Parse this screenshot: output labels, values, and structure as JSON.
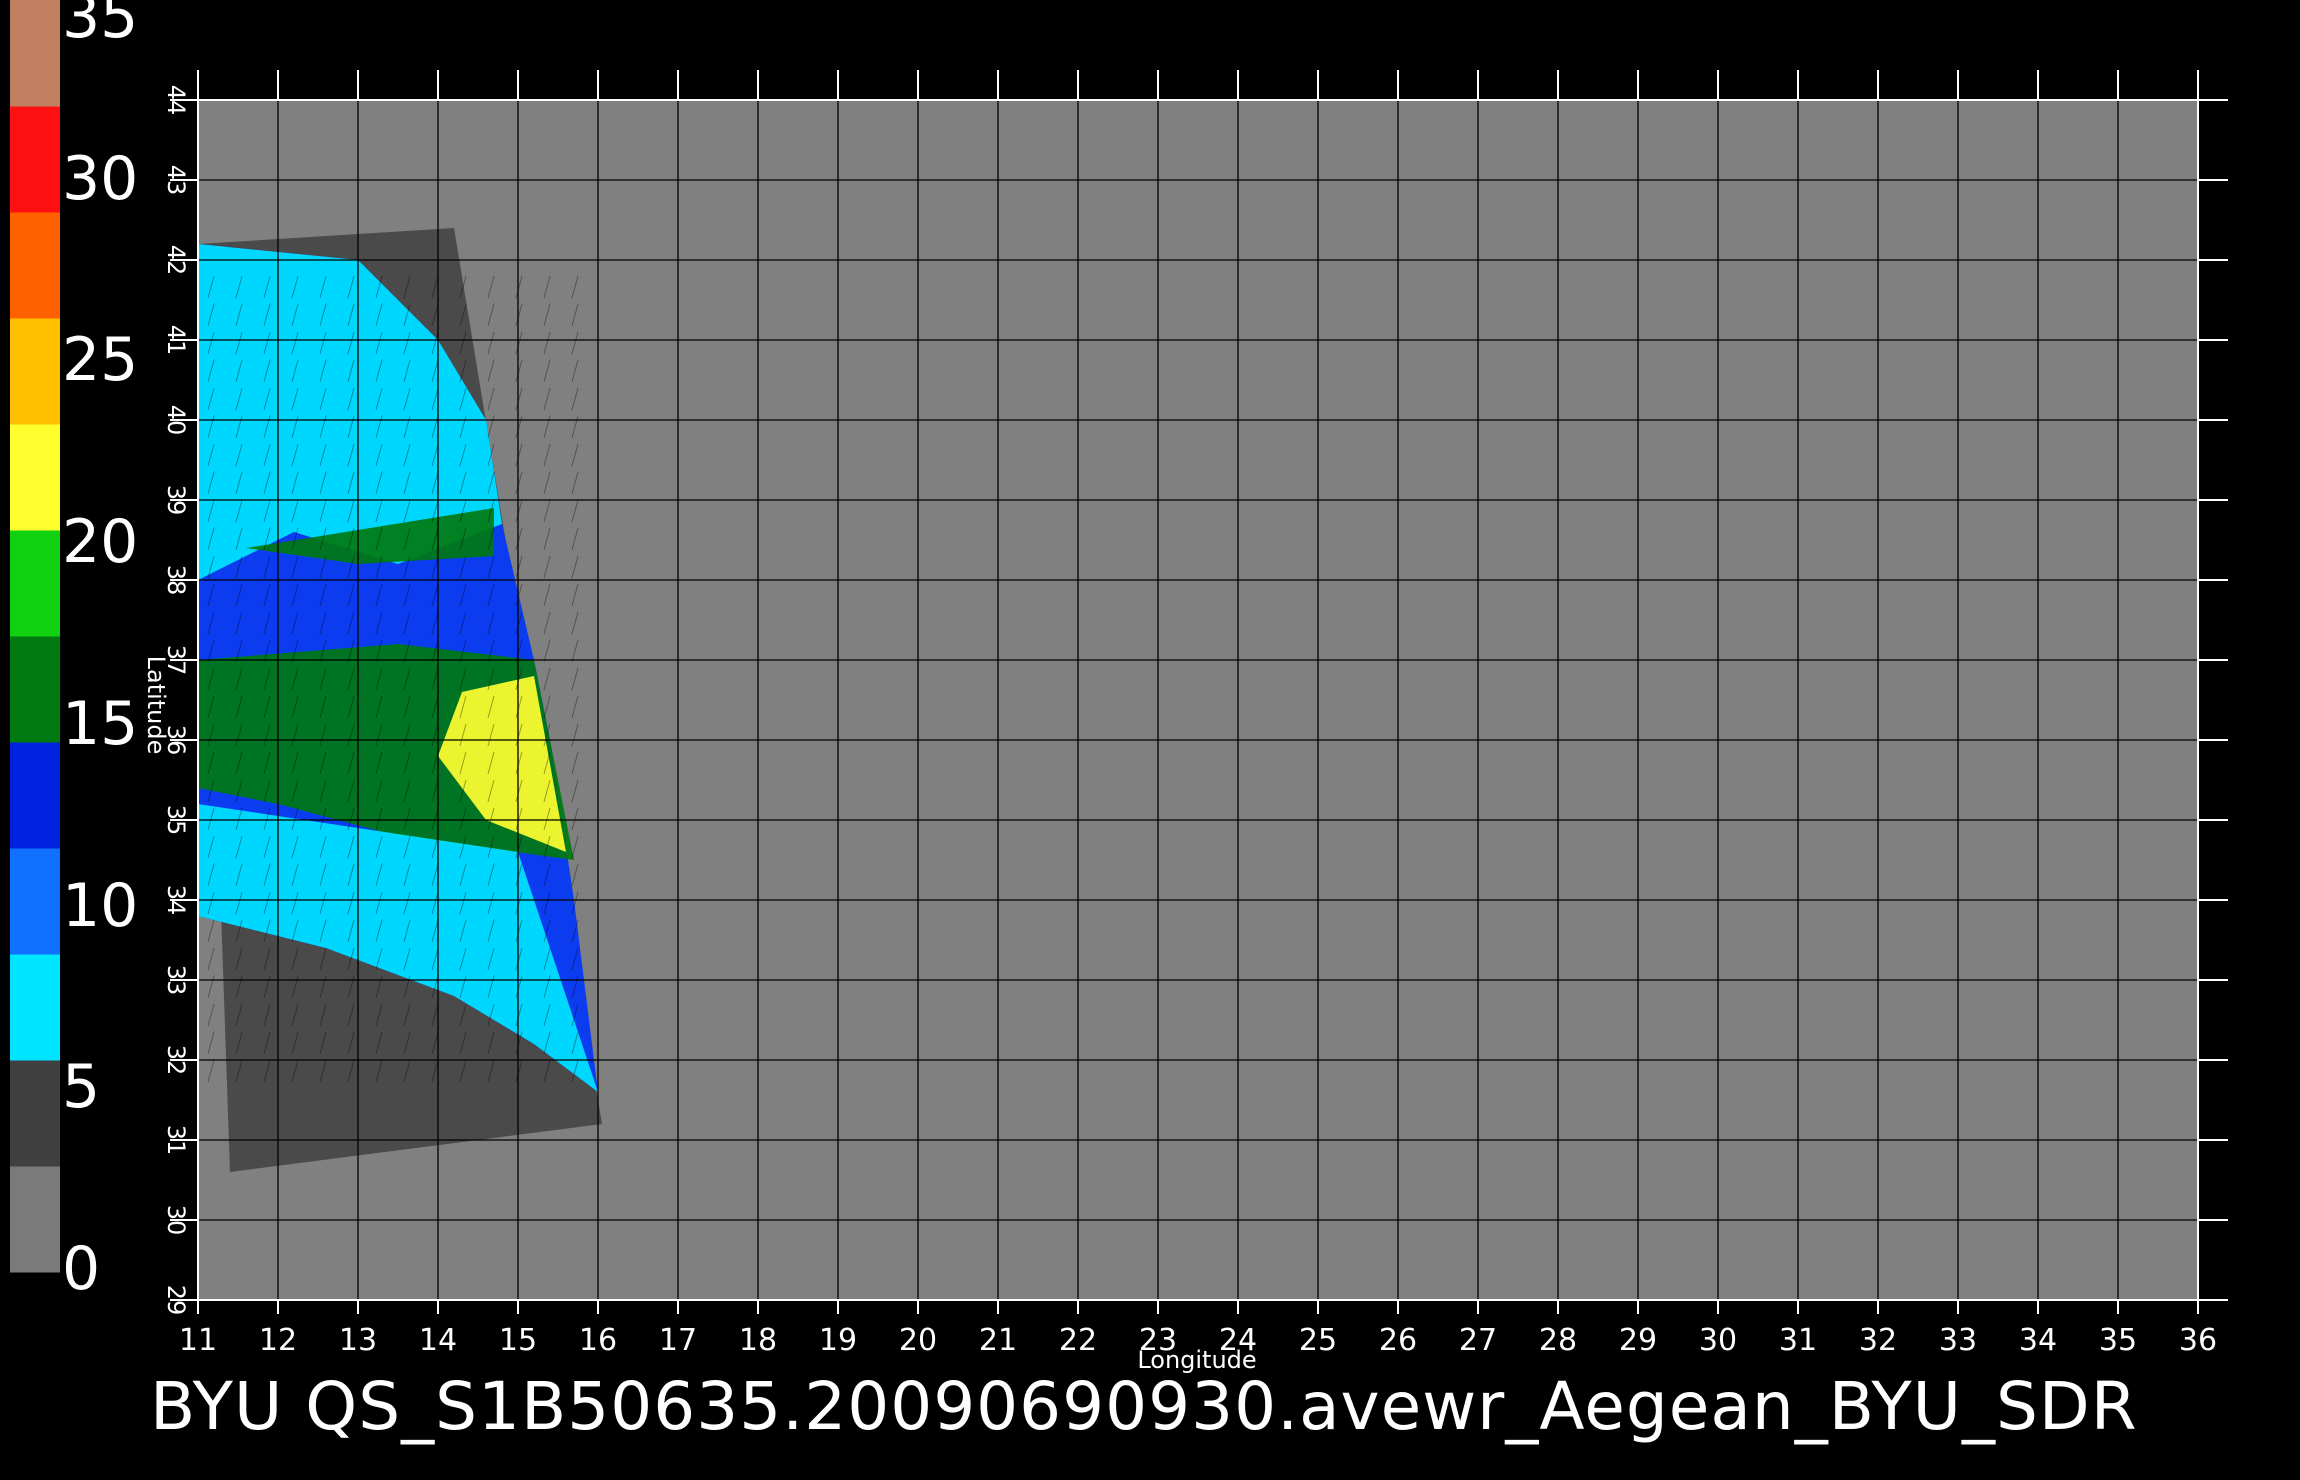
{
  "title": "BYU  QS_S1B50635.20090690930.avewr_Aegean_BYU_SDR",
  "map": {
    "xlabel": "Longitude",
    "ylabel": "Latitude",
    "lon_range": [
      11,
      36
    ],
    "lat_range": [
      29,
      44
    ],
    "lon_ticks": [
      "11",
      "12",
      "13",
      "14",
      "15",
      "16",
      "17",
      "18",
      "19",
      "20",
      "21",
      "22",
      "23",
      "24",
      "25",
      "26",
      "27",
      "28",
      "29",
      "30",
      "31",
      "32",
      "33",
      "34",
      "35",
      "36"
    ],
    "lat_ticks": [
      "29",
      "30",
      "31",
      "32",
      "33",
      "34",
      "35",
      "36",
      "37",
      "38",
      "39",
      "40",
      "41",
      "42",
      "43",
      "44"
    ],
    "background_color": "#808080",
    "land_color": "#4a4a4a"
  },
  "colorbar": {
    "ticks": [
      "0",
      "5",
      "10",
      "15",
      "20",
      "25",
      "30",
      "35"
    ],
    "range": [
      0,
      35
    ],
    "colors": [
      "#7a7a7a",
      "#404040",
      "#00e5ff",
      "#1070ff",
      "#0022e0",
      "#007a10",
      "#10d010",
      "#ffff30",
      "#ffc000",
      "#ff6000",
      "#ff1010",
      "#c08060"
    ]
  },
  "swath": {
    "footprint": [
      [
        11.0,
        42.2
      ],
      [
        14.2,
        42.4
      ],
      [
        16.05,
        31.2
      ],
      [
        11.4,
        30.6
      ]
    ],
    "data_region": [
      [
        11.0,
        42.2
      ],
      [
        13.0,
        42.0
      ],
      [
        14.0,
        41.0
      ],
      [
        14.6,
        40.0
      ],
      [
        14.8,
        38.7
      ],
      [
        15.2,
        37.0
      ],
      [
        15.4,
        36.0
      ],
      [
        15.7,
        34.0
      ],
      [
        16.0,
        31.6
      ],
      [
        15.2,
        32.2
      ],
      [
        14.2,
        32.8
      ],
      [
        12.6,
        33.4
      ],
      [
        11.0,
        33.8
      ]
    ],
    "wind_bands": [
      {
        "value": 8,
        "poly": [
          [
            11.0,
            42.2
          ],
          [
            13.0,
            42.0
          ],
          [
            14.0,
            41.0
          ],
          [
            14.6,
            40.0
          ],
          [
            14.8,
            38.7
          ],
          [
            13.5,
            38.2
          ],
          [
            12.2,
            38.6
          ],
          [
            11.0,
            38.0
          ]
        ]
      },
      {
        "value": 17,
        "poly": [
          [
            11.6,
            38.4
          ],
          [
            14.7,
            38.9
          ],
          [
            14.7,
            38.3
          ],
          [
            13.0,
            38.2
          ]
        ]
      },
      {
        "value": 16,
        "poly": [
          [
            11.0,
            37.0
          ],
          [
            13.5,
            37.2
          ],
          [
            15.2,
            37.0
          ],
          [
            15.4,
            36.0
          ],
          [
            15.7,
            34.5
          ],
          [
            13.5,
            34.8
          ],
          [
            12.0,
            35.2
          ],
          [
            11.0,
            35.4
          ]
        ]
      },
      {
        "value": 22,
        "poly": [
          [
            14.3,
            36.6
          ],
          [
            15.2,
            36.8
          ],
          [
            15.6,
            34.6
          ],
          [
            14.6,
            35.0
          ],
          [
            14.0,
            35.8
          ]
        ]
      },
      {
        "value": 8,
        "poly": [
          [
            11.0,
            35.2
          ],
          [
            15.0,
            34.6
          ],
          [
            16.0,
            31.6
          ],
          [
            15.2,
            32.2
          ],
          [
            14.2,
            32.8
          ],
          [
            12.6,
            33.4
          ],
          [
            11.0,
            33.8
          ]
        ]
      }
    ]
  }
}
